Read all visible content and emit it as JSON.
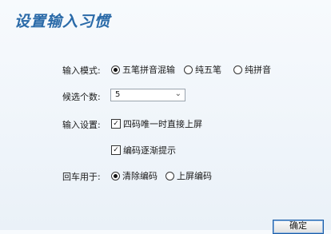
{
  "title": "设置输入习惯",
  "input_mode": {
    "label": "输入模式:",
    "options": [
      "五笔拼音混输",
      "纯五笔",
      "纯拼音"
    ],
    "selected": "五笔拼音混输"
  },
  "candidates": {
    "label": "候选个数:",
    "value": "5",
    "chevron": "chevron-down-icon"
  },
  "input_settings": {
    "label": "输入设置:",
    "checkboxes": [
      {
        "label": "四码唯一时直接上屏",
        "checked": true
      },
      {
        "label": "编码逐渐提示",
        "checked": true
      }
    ]
  },
  "enter_key": {
    "label": "回车用于:",
    "options": [
      "清除编码",
      "上屏编码"
    ],
    "selected": "清除编码"
  },
  "ok_button": "确定"
}
